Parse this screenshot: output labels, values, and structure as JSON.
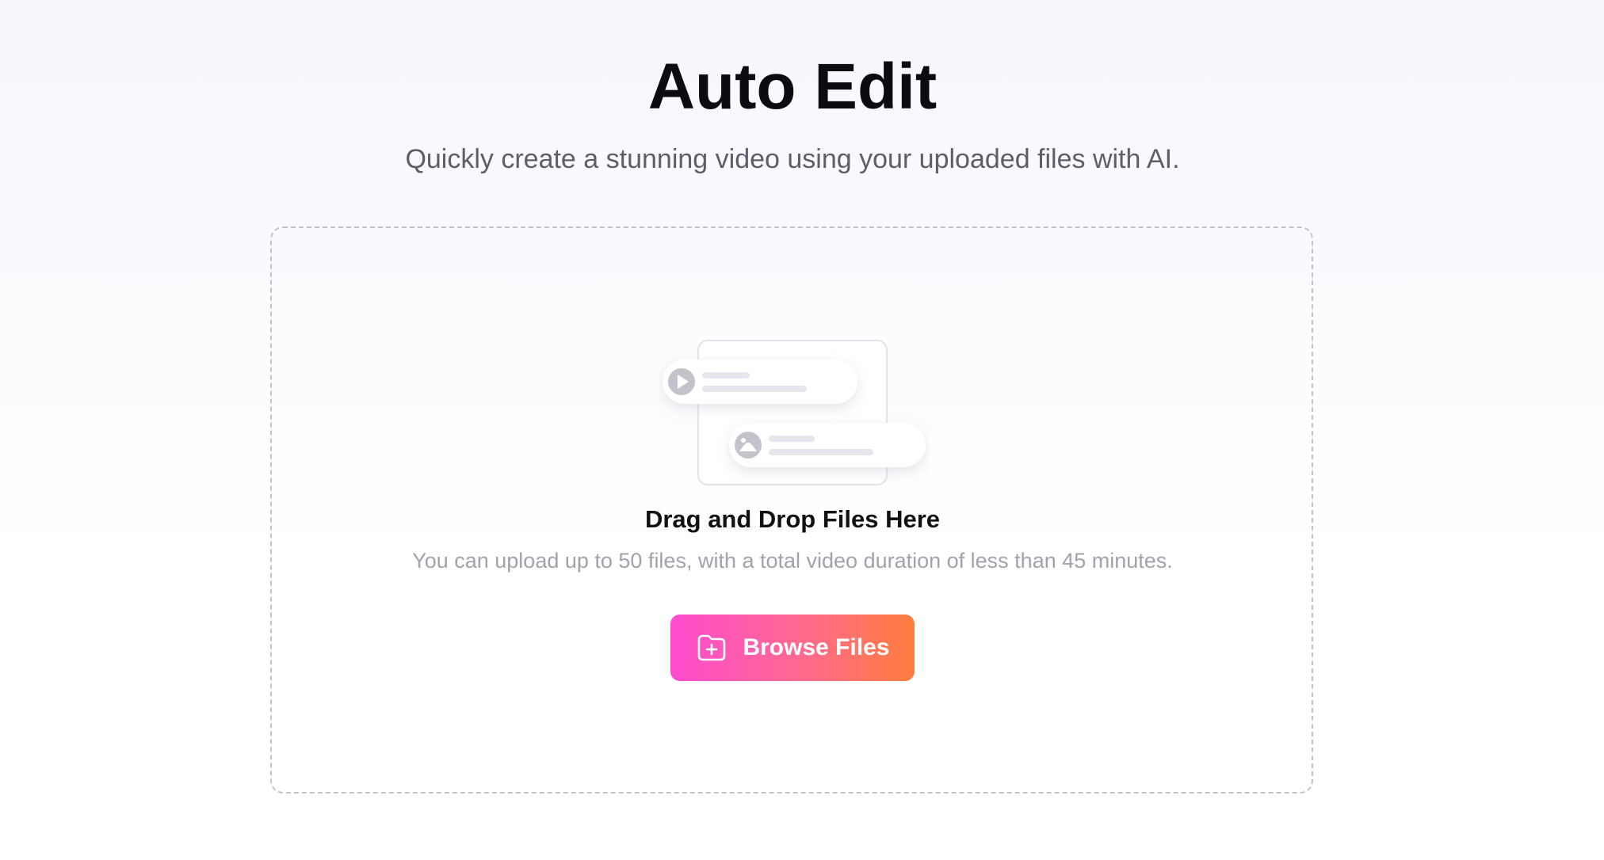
{
  "header": {
    "title": "Auto Edit",
    "subtitle": "Quickly create a stunning video using your uploaded files with AI."
  },
  "upload": {
    "drop_title": "Drag and Drop Files Here",
    "drop_hint": "You can upload up to 50 files, with a total video duration of less than 45 minutes.",
    "browse_label": "Browse Files",
    "browse_icon": "folder-plus-icon"
  },
  "colors": {
    "button_gradient_start": "#ff4bd1",
    "button_gradient_end": "#ff7d3c",
    "title": "#0b0b10",
    "subtitle": "#5e5e66",
    "hint": "#a2a2ab",
    "dashed_border": "#c2c2c9"
  }
}
